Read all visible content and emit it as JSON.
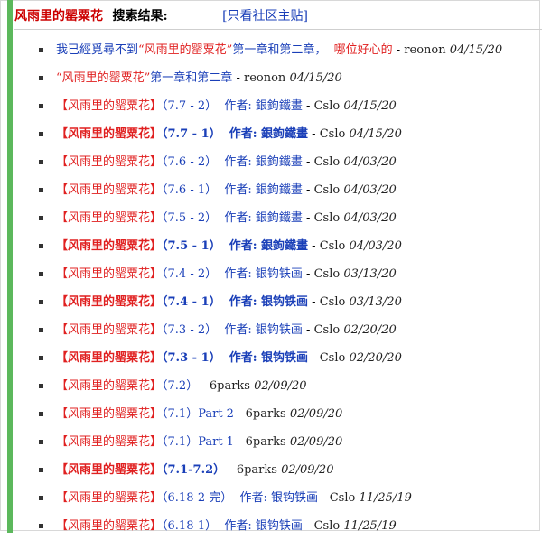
{
  "header": {
    "keyword": "风雨里的罂粟花",
    "label": "搜索结果:",
    "only_link": "[只看社区主贴]"
  },
  "colors": {
    "red": "#e02020",
    "blue": "#1a3fb8",
    "stripe": "#5cb85c"
  },
  "results": [
    {
      "kind": "plain",
      "bold": false,
      "pre": "我已經覓尋不到",
      "quote": "“风雨里的罂粟花”",
      "mid": "第一章和第二章，",
      "tail": "哪位好心的",
      "author": "reonon",
      "date": "04/15/20"
    },
    {
      "kind": "plain2",
      "bold": false,
      "quote": "“风雨里的罂粟花”",
      "mid": "第一章和第二章",
      "author": "reonon",
      "date": "04/15/20"
    },
    {
      "kind": "bk",
      "bold": false,
      "title": "【风雨里的罂粟花】",
      "chapter": "（7.7 - 2）",
      "byline": "作者: 銀鉤鐵畫",
      "author": "Cslo",
      "date": "04/15/20"
    },
    {
      "kind": "bk",
      "bold": true,
      "title": "【风雨里的罂粟花】",
      "chapter": "（7.7 - 1）",
      "byline": "作者: 銀鉤鐵畫",
      "author": "Cslo",
      "date": "04/15/20"
    },
    {
      "kind": "bk",
      "bold": false,
      "title": "【风雨里的罂粟花】",
      "chapter": "（7.6 - 2）",
      "byline": "作者: 銀鉤鐵畫",
      "author": "Cslo",
      "date": "04/03/20"
    },
    {
      "kind": "bk",
      "bold": false,
      "title": "【风雨里的罂粟花】",
      "chapter": "（7.6 - 1）",
      "byline": "作者: 銀鉤鐵畫",
      "author": "Cslo",
      "date": "04/03/20"
    },
    {
      "kind": "bk",
      "bold": false,
      "title": "【风雨里的罂粟花】",
      "chapter": "（7.5 - 2）",
      "byline": "作者: 銀鉤鐵畫",
      "author": "Cslo",
      "date": "04/03/20"
    },
    {
      "kind": "bk",
      "bold": true,
      "title": "【风雨里的罂粟花】",
      "chapter": "（7.5 - 1）",
      "byline": "作者: 銀鉤鐵畫",
      "author": "Cslo",
      "date": "04/03/20"
    },
    {
      "kind": "bk",
      "bold": false,
      "title": "【风雨里的罂粟花】",
      "chapter": "（7.4 - 2）",
      "byline": "作者: 银钩铁画",
      "author": "Cslo",
      "date": "03/13/20"
    },
    {
      "kind": "bk",
      "bold": true,
      "title": "【风雨里的罂粟花】",
      "chapter": "（7.4 - 1）",
      "byline": "作者: 银钩铁画",
      "author": "Cslo",
      "date": "03/13/20"
    },
    {
      "kind": "bk",
      "bold": false,
      "title": "【风雨里的罂粟花】",
      "chapter": "（7.3 - 2）",
      "byline": "作者: 银钩铁画",
      "author": "Cslo",
      "date": "02/20/20"
    },
    {
      "kind": "bk",
      "bold": true,
      "title": "【风雨里的罂粟花】",
      "chapter": "（7.3 - 1）",
      "byline": "作者: 银钩铁画",
      "author": "Cslo",
      "date": "02/20/20"
    },
    {
      "kind": "bk",
      "bold": false,
      "title": "【风雨里的罂粟花】",
      "chapter": "（7.2）",
      "byline": "",
      "author": "6parks",
      "date": "02/09/20"
    },
    {
      "kind": "bk",
      "bold": false,
      "title": "【风雨里的罂粟花】",
      "chapter": "（7.1）Part 2",
      "byline": "",
      "author": "6parks",
      "date": "02/09/20"
    },
    {
      "kind": "bk",
      "bold": false,
      "title": "【风雨里的罂粟花】",
      "chapter": "（7.1）Part 1",
      "byline": "",
      "author": "6parks",
      "date": "02/09/20"
    },
    {
      "kind": "bk",
      "bold": true,
      "title": "【风雨里的罂粟花】",
      "chapter": "（7.1-7.2）",
      "byline": "",
      "author": "6parks",
      "date": "02/09/20"
    },
    {
      "kind": "bk",
      "bold": false,
      "title": "【风雨里的罂粟花】",
      "chapter": "（6.18-2 完）",
      "byline": "作者: 银钩铁画",
      "author": "Cslo",
      "date": "11/25/19"
    },
    {
      "kind": "bk",
      "bold": false,
      "title": "【风雨里的罂粟花】",
      "chapter": "（6.18-1）",
      "byline": "作者: 银钩铁画",
      "author": "Cslo",
      "date": "11/25/19"
    }
  ]
}
